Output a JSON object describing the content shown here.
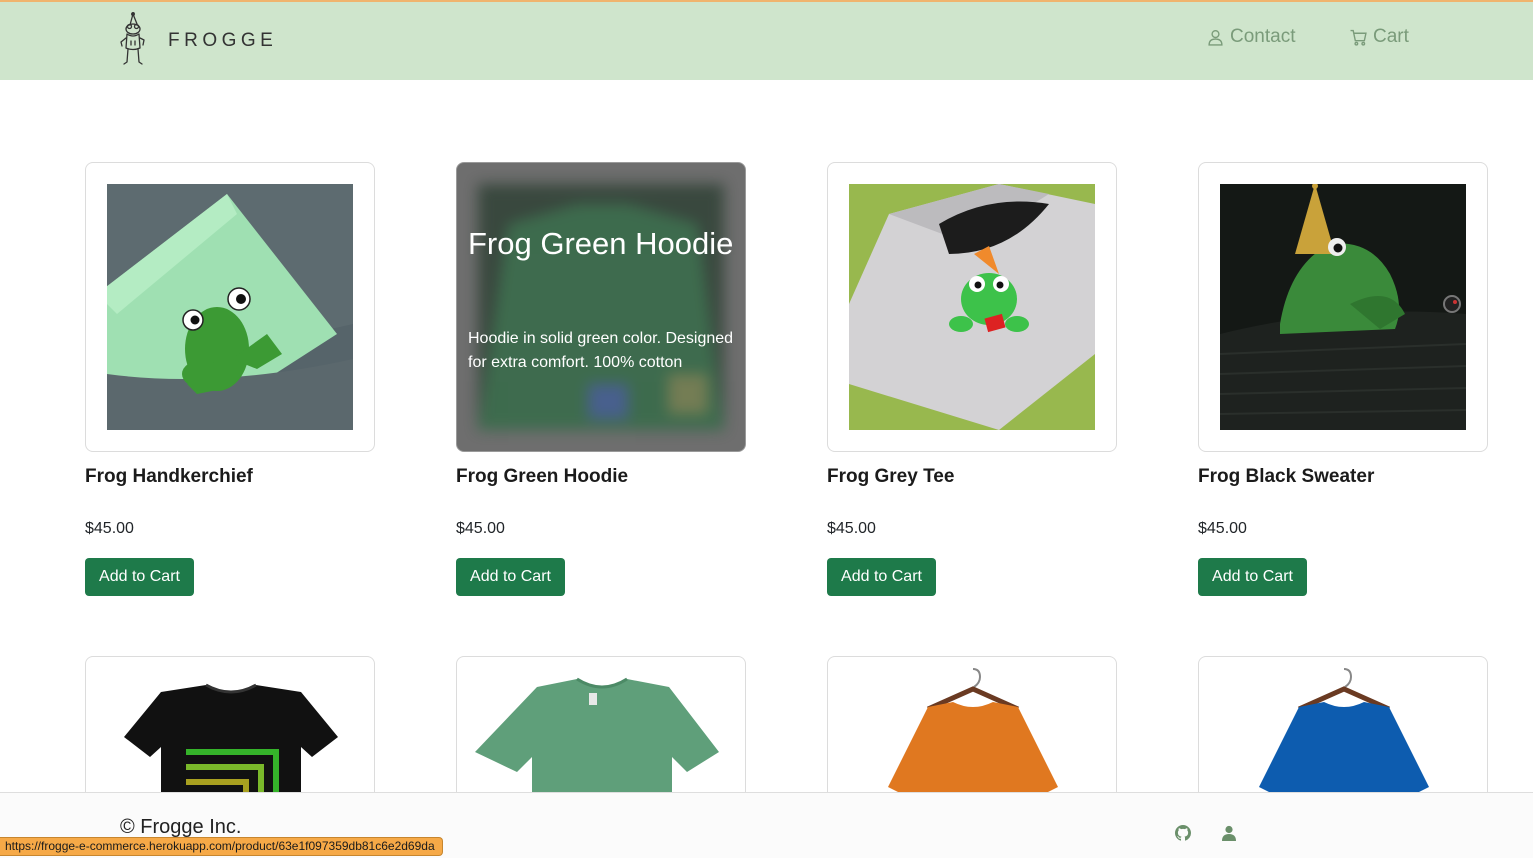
{
  "navbar": {
    "brand": "FROGGE",
    "links": [
      {
        "label": "Contact",
        "icon": "person-icon"
      },
      {
        "label": "Cart",
        "icon": "cart-icon"
      }
    ],
    "background": "#cfe5cc"
  },
  "products": [
    {
      "name": "Frog Handkerchief",
      "price": "$45.00",
      "button": "Add to Cart"
    },
    {
      "name": "Frog Green Hoodie",
      "price": "$45.00",
      "button": "Add to Cart",
      "hover_title": "Frog Green Hoodie",
      "hover_description": "Hoodie in solid green color. Designed for extra comfort. 100% cotton"
    },
    {
      "name": "Frog Grey Tee",
      "price": "$45.00",
      "button": "Add to Cart"
    },
    {
      "name": "Frog Black Sweater",
      "price": "$45.00",
      "button": "Add to Cart"
    }
  ],
  "accent_color": "#1e7a4a",
  "footer": {
    "copyright": "© Frogge Inc.",
    "icons": [
      "github-icon",
      "user-icon"
    ]
  },
  "status_bar": {
    "url": "https://frogge-e-commerce.herokuapp.com/product/63e1f097359db81c6e2d69da"
  }
}
